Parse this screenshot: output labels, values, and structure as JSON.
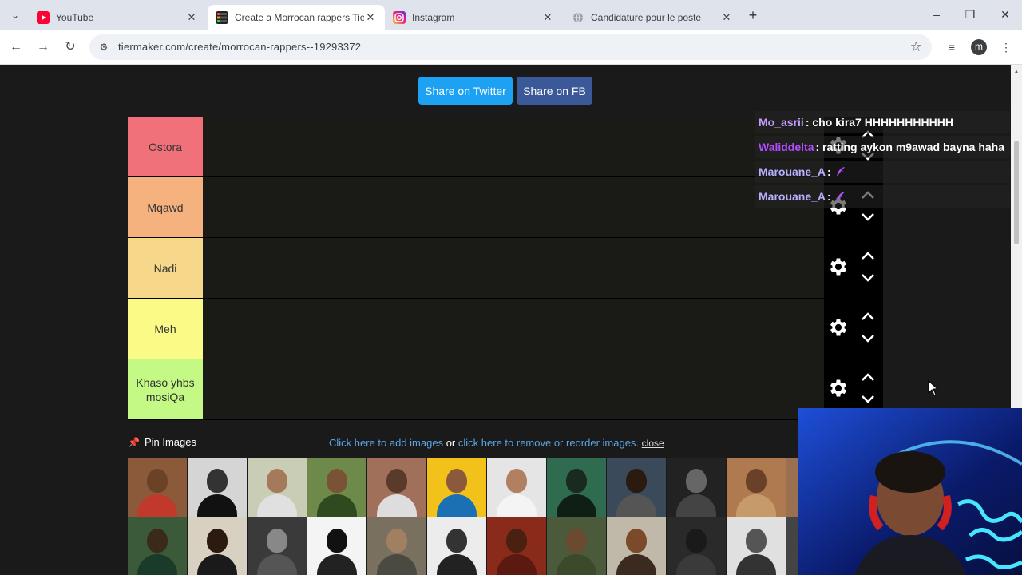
{
  "browser": {
    "tabs": [
      {
        "title": "YouTube",
        "icon": "youtube-icon",
        "active": false
      },
      {
        "title": "Create a Morrocan rappers Tier",
        "icon": "tiermaker-icon",
        "active": true
      },
      {
        "title": "Instagram",
        "icon": "instagram-icon",
        "active": false
      },
      {
        "title": "Candidature pour le poste",
        "icon": "globe-icon",
        "active": false
      }
    ],
    "url": "tiermaker.com/create/morrocan-rappers--19293372",
    "profile_initial": "m"
  },
  "share": {
    "twitter_label": "Share on Twitter",
    "facebook_label": "Share on FB"
  },
  "tiers": [
    {
      "label": "Ostora",
      "color": "#f0717a"
    },
    {
      "label": "Mqawd",
      "color": "#f5b27f"
    },
    {
      "label": "Nadi",
      "color": "#f7d78a"
    },
    {
      "label": "Meh",
      "color": "#fbfa87"
    },
    {
      "label": "Khaso yhbs mosiQa",
      "color": "#c3f984"
    }
  ],
  "pin": {
    "title": "Pin Images",
    "add_link": "Click here to add images",
    "or_text": "or",
    "remove_link": "click here to remove or reorder images.",
    "close_label": "close"
  },
  "chat": [
    {
      "user": "Mo_asrii",
      "user_color": "#c39bff",
      "message": ": cho kira7 HHHHHHHHHHH"
    },
    {
      "user": "Waliddelta",
      "user_color": "#b44cff",
      "message": ": ratting aykon m9awad bayna haha"
    },
    {
      "user": "Marouane_A",
      "user_color": "#b7b0ff",
      "message": ":"
    },
    {
      "user": "Marouane_A",
      "user_color": "#b7b0ff",
      "message": ":"
    }
  ],
  "colors": {
    "page_bg": "#1a1a1b",
    "twitter": "#1da1f2",
    "facebook": "#3b5998",
    "link": "#5aa6e6"
  }
}
